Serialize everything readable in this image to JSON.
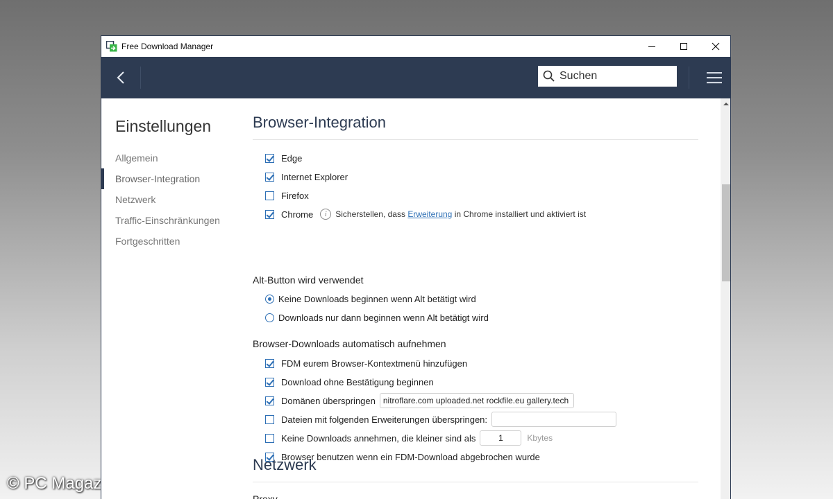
{
  "window": {
    "title": "Free Download Manager"
  },
  "titlebar_controls": {
    "minimize": "—",
    "maximize": "☐",
    "close": "✕"
  },
  "toolbar": {
    "search_placeholder": "Suchen"
  },
  "sidebar": {
    "title": "Einstellungen",
    "items": [
      {
        "label": "Allgemein",
        "active": false
      },
      {
        "label": "Browser-Integration",
        "active": true
      },
      {
        "label": "Netzwerk",
        "active": false
      },
      {
        "label": "Traffic-Einschränkungen",
        "active": false
      },
      {
        "label": "Fortgeschritten",
        "active": false
      }
    ]
  },
  "browser_integration": {
    "heading": "Browser-Integration",
    "browsers": [
      {
        "label": "Edge",
        "checked": true
      },
      {
        "label": "Internet Explorer",
        "checked": true
      },
      {
        "label": "Firefox",
        "checked": false
      },
      {
        "label": "Chrome",
        "checked": true
      }
    ],
    "chrome_note_prefix": "Sicherstellen, dass",
    "chrome_note_link": "Erweiterung",
    "chrome_note_suffix": "in Chrome installiert und aktiviert ist",
    "alt_heading": "Alt-Button wird verwendet",
    "alt_options": [
      {
        "label": "Keine Downloads beginnen wenn Alt betätigt wird",
        "selected": true
      },
      {
        "label": "Downloads nur dann beginnen wenn Alt betätigt wird",
        "selected": false
      }
    ],
    "capture_heading": "Browser-Downloads automatisch aufnehmen",
    "capture_options": {
      "context_menu": {
        "label": "FDM eurem Browser-Kontextmenü hinzufügen",
        "checked": true
      },
      "no_confirm": {
        "label": "Download ohne Bestätigung beginnen",
        "checked": true
      },
      "skip_domains": {
        "label": "Domänen überspringen",
        "checked": true,
        "value": "nitroflare.com uploaded.net rockfile.eu gallery.tech"
      },
      "skip_extensions": {
        "label": "Dateien mit folgenden Erweiterungen überspringen:",
        "checked": false,
        "value": ""
      },
      "min_size": {
        "label": "Keine Downloads annehmen, die kleiner sind als",
        "checked": false,
        "value": "1",
        "unit": "Kbytes"
      },
      "use_browser": {
        "label": "Browser benutzen wenn ein FDM-Download abgebrochen wurde",
        "checked": true
      }
    }
  },
  "network": {
    "heading": "Netzwerk",
    "proxy_label": "Proxy"
  },
  "colors": {
    "toolbar": "#2d3b52",
    "accent": "#2d6fb5"
  },
  "watermark": "© PC Magazin"
}
